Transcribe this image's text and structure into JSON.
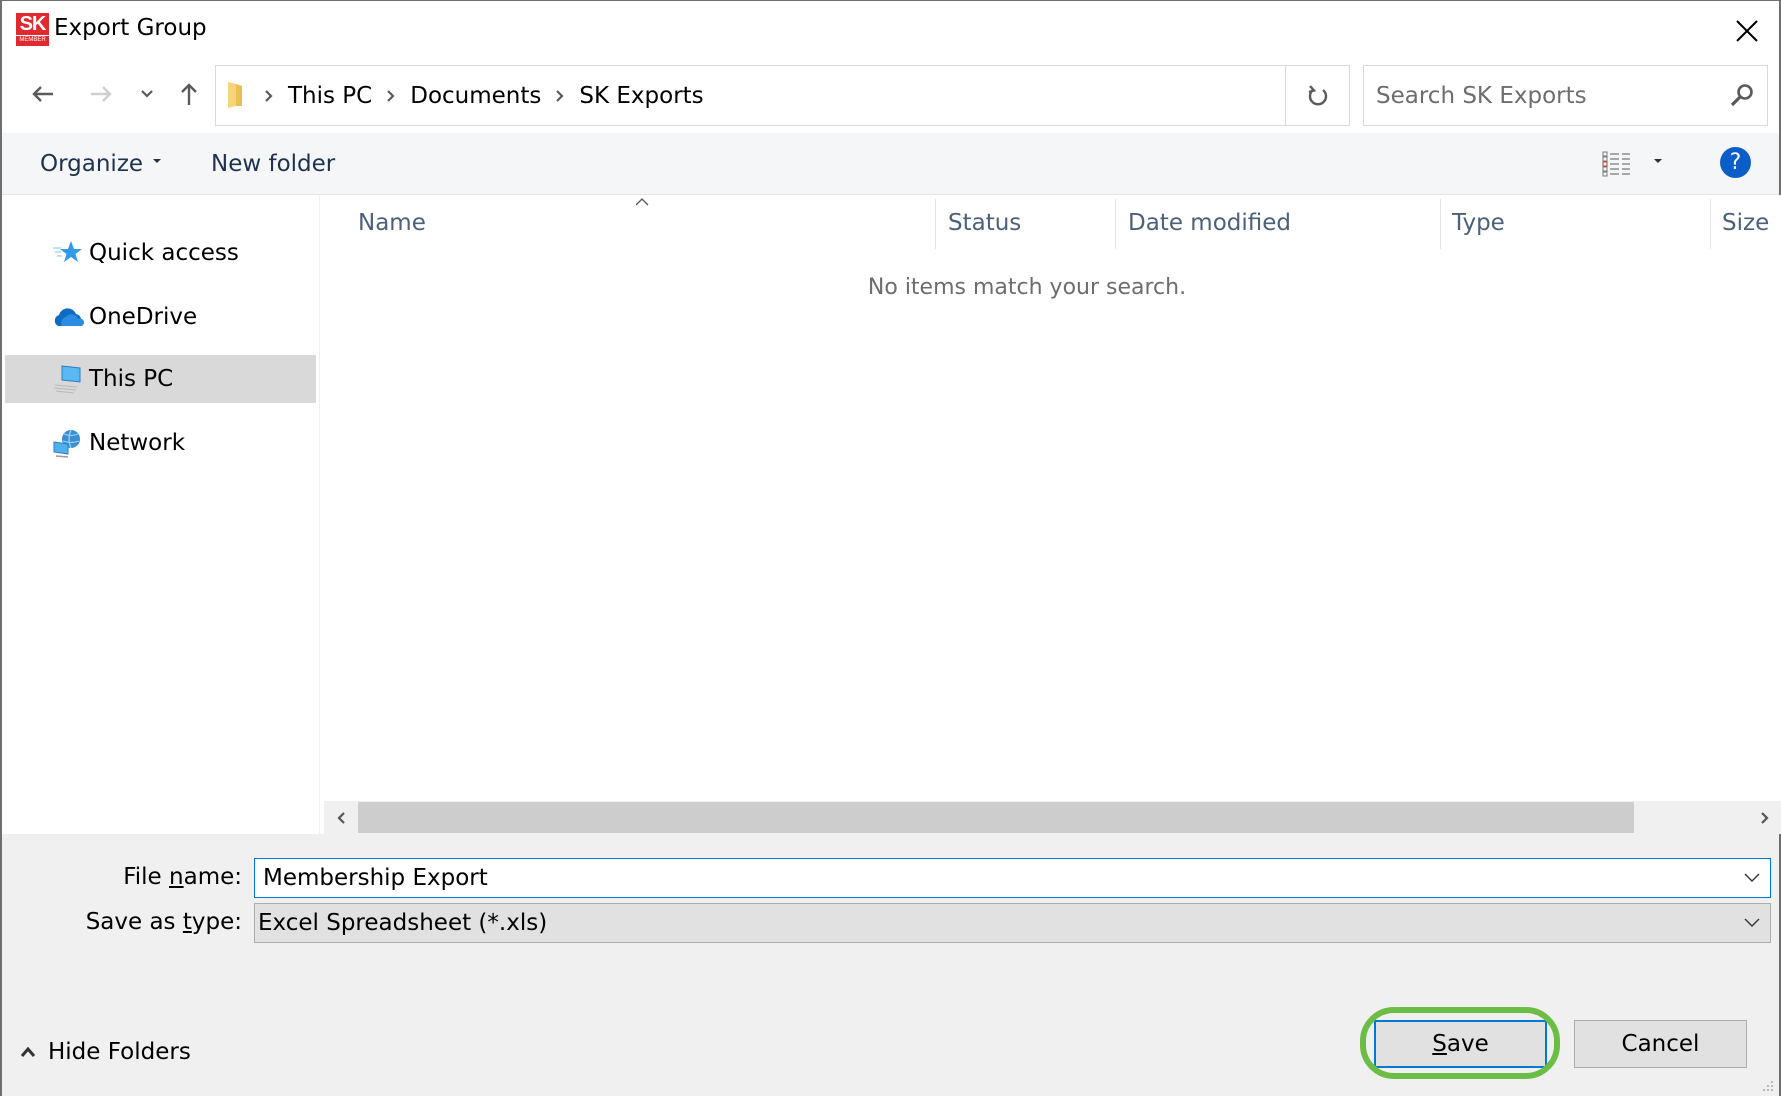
{
  "window": {
    "title": "Export Group",
    "app_logo": {
      "line1": "SK",
      "line2": "MEMBER",
      "color": "#e02a2f"
    },
    "close_icon": "close-icon"
  },
  "navigation": {
    "back_icon": "arrow-left-icon",
    "forward_icon": "arrow-right-icon",
    "recent_icon": "chevron-down-icon",
    "up_icon": "arrow-up-icon",
    "breadcrumbs": [
      "This PC",
      "Documents",
      "SK Exports"
    ],
    "refresh_icon": "refresh-icon",
    "search": {
      "placeholder": "Search SK Exports",
      "value": ""
    }
  },
  "toolbar": {
    "organize_label": "Organize",
    "new_folder_label": "New folder",
    "view_icon": "details-view-icon",
    "help_label": "?"
  },
  "sidebar": {
    "items": [
      {
        "label": "Quick access",
        "icon": "star-icon",
        "selected": false
      },
      {
        "label": "OneDrive",
        "icon": "cloud-icon",
        "selected": false
      },
      {
        "label": "This PC",
        "icon": "computer-icon",
        "selected": true
      },
      {
        "label": "Network",
        "icon": "network-icon",
        "selected": false
      }
    ]
  },
  "file_list": {
    "columns": [
      "Name",
      "Status",
      "Date modified",
      "Type",
      "Size"
    ],
    "sort_column": "Name",
    "sort_direction": "ascending",
    "empty_message": "No items match your search.",
    "rows": []
  },
  "form": {
    "file_name_label_pre": "File ",
    "file_name_label_accel": "n",
    "file_name_label_post": "ame:",
    "file_name_value": "Membership Export",
    "save_type_label_pre": "Save as ",
    "save_type_label_accel": "t",
    "save_type_label_post": "ype:",
    "save_type_value": "Excel Spreadsheet (*.xls)"
  },
  "footer": {
    "hide_folders_label": "Hide Folders",
    "save_accel": "S",
    "save_rest": "ave",
    "cancel_label": "Cancel",
    "highlight_color": "#6cbd45"
  }
}
